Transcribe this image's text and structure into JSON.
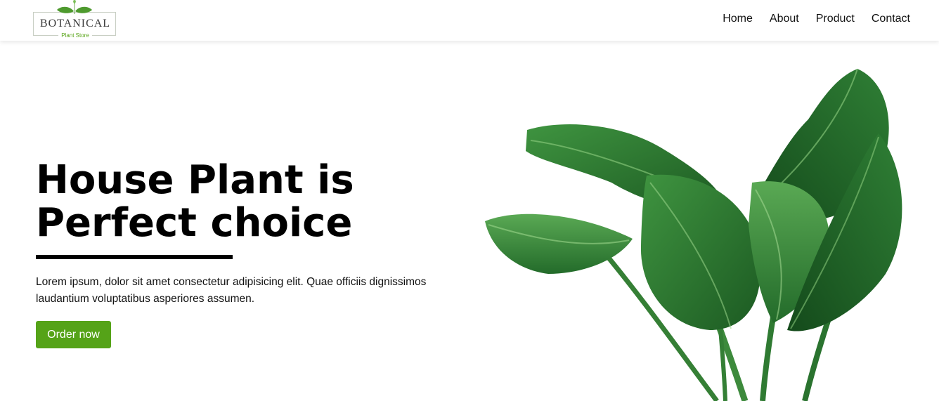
{
  "logo": {
    "title": "BOTANICAL",
    "subtitle": "Plant Store",
    "icon": "leaf-pair-icon"
  },
  "nav": {
    "items": [
      {
        "label": "Home"
      },
      {
        "label": "About"
      },
      {
        "label": "Product"
      },
      {
        "label": "Contact"
      }
    ]
  },
  "hero": {
    "title": "House Plant is Perfect choice",
    "text": "Lorem ipsum, dolor sit amet consectetur adipisicing elit. Quae officiis dignissimos laudantium voluptatibus asperiores assumen.",
    "button_label": "Order now",
    "image": "alocasia-house-plant-image"
  },
  "colors": {
    "accent": "#55a318",
    "leaf_dark": "#1f5e24",
    "leaf_mid": "#2f7d32",
    "leaf_light": "#4fa14a"
  }
}
